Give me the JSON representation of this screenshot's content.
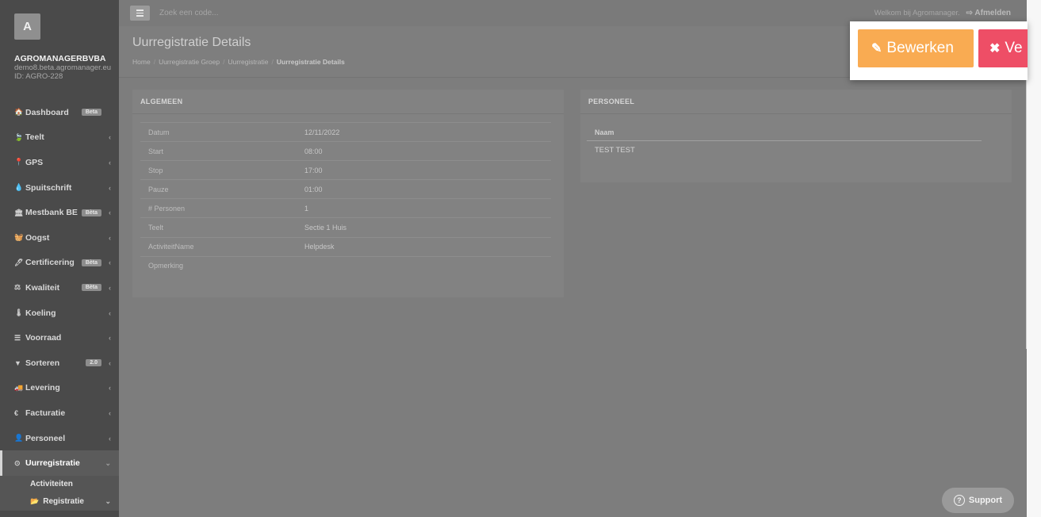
{
  "sidebar": {
    "avatar_letter": "A",
    "company": "AGROMANAGERBVBA",
    "email": "demo8.beta.agromanager.eu",
    "id": "ID: AGRO-228",
    "items": [
      {
        "icon": "🏠",
        "label": "Dashboard",
        "badge": "Beta",
        "chev": ""
      },
      {
        "icon": "🍃",
        "label": "Teelt",
        "badge": "",
        "chev": "‹"
      },
      {
        "icon": "📍",
        "label": "GPS",
        "badge": "",
        "chev": "‹"
      },
      {
        "icon": "💧",
        "label": "Spuitschrift",
        "badge": "",
        "chev": "‹"
      },
      {
        "icon": "🏛",
        "label": "Mestbank BE",
        "badge": "Bèta",
        "chev": "‹"
      },
      {
        "icon": "🧺",
        "label": "Oogst",
        "badge": "",
        "chev": "‹"
      },
      {
        "icon": "🖊",
        "label": "Certificering",
        "badge": "Bèta",
        "chev": "‹"
      },
      {
        "icon": "⚖",
        "label": "Kwaliteit",
        "badge": "Bèta",
        "chev": "‹"
      },
      {
        "icon": "🌡",
        "label": "Koeling",
        "badge": "",
        "chev": "‹"
      },
      {
        "icon": "☰",
        "label": "Voorraad",
        "badge": "",
        "chev": "‹"
      },
      {
        "icon": "▼",
        "label": "Sorteren",
        "badge": "2.0",
        "chev": "‹"
      },
      {
        "icon": "🚚",
        "label": "Levering",
        "badge": "",
        "chev": "‹"
      },
      {
        "icon": "€",
        "label": "Facturatie",
        "badge": "",
        "chev": "‹"
      },
      {
        "icon": "👤",
        "label": "Personeel",
        "badge": "",
        "chev": "‹"
      },
      {
        "icon": "⊙",
        "label": "Uurregistratie",
        "badge": "",
        "chev": "⌄"
      }
    ],
    "sub_items": [
      {
        "label": "Activiteiten"
      },
      {
        "label": "Registratie",
        "icon": "📂",
        "chev": "⌄"
      }
    ]
  },
  "topbar": {
    "search_placeholder": "Zoek een code...",
    "welcome": "Welkom bij Agromanager.",
    "logout": "⇨ Afmelden"
  },
  "page": {
    "title": "Uurregistratie Details",
    "breadcrumb": [
      "Home",
      "Uurregistratie Groep",
      "Uurregistratie",
      "Uurregistratie Details"
    ],
    "breadcrumb_sep": "/"
  },
  "algemeen": {
    "title": "ALGEMEEN",
    "rows": [
      {
        "key": "Datum",
        "value": "12/11/2022"
      },
      {
        "key": "Start",
        "value": "08:00"
      },
      {
        "key": "Stop",
        "value": "17:00"
      },
      {
        "key": "Pauze",
        "value": "01:00"
      },
      {
        "key": "# Personen",
        "value": "1"
      },
      {
        "key": "Teelt",
        "value": "Sectie 1 Huis"
      },
      {
        "key": "ActiviteitName",
        "value": "Helpdesk"
      },
      {
        "key": "Opmerking",
        "value": ""
      }
    ]
  },
  "personeel": {
    "title": "PERSONEEL",
    "header": "Naam",
    "rows": [
      "TEST TEST"
    ]
  },
  "actions": {
    "edit_icon": "✎",
    "edit_label": "Bewerken",
    "delete_icon": "✖",
    "delete_label": "Ve"
  },
  "support": {
    "icon": "?",
    "label": "Support"
  }
}
